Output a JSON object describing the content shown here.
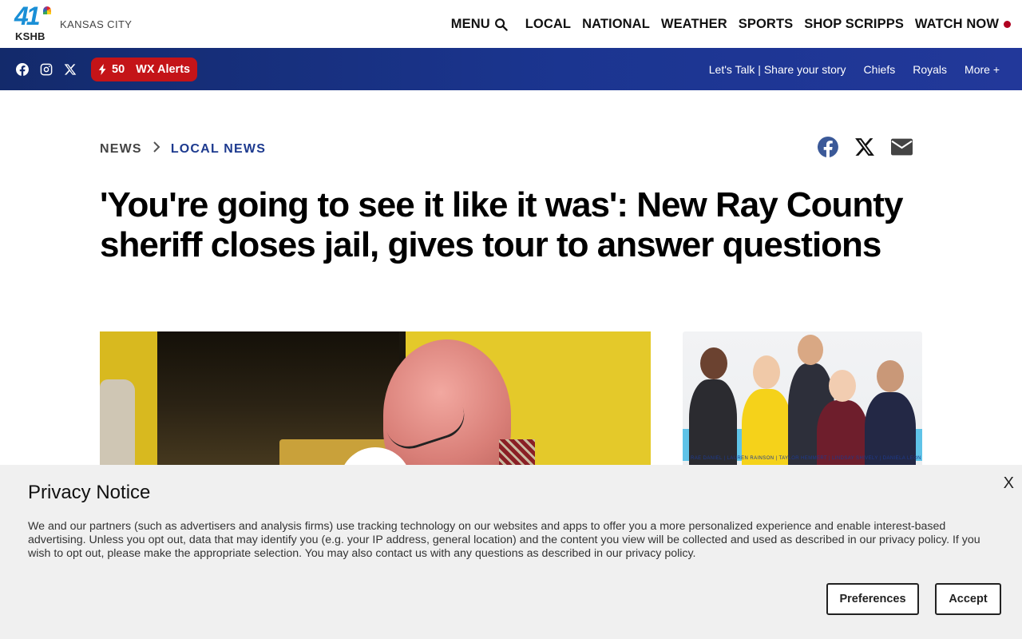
{
  "header": {
    "logo_number": "41",
    "logo_call": "KSHB",
    "city": "KANSAS CITY",
    "nav": [
      {
        "label": "MENU"
      },
      {
        "label": "LOCAL"
      },
      {
        "label": "NATIONAL"
      },
      {
        "label": "WEATHER"
      },
      {
        "label": "SPORTS"
      },
      {
        "label": "SHOP SCRIPPS"
      },
      {
        "label": "WATCH NOW"
      }
    ]
  },
  "subbar": {
    "social_icons": [
      "facebook-icon",
      "instagram-icon",
      "x-icon"
    ],
    "alerts_count": "50",
    "alerts_label": "WX Alerts",
    "links": [
      {
        "label": "Let's Talk | Share your story"
      },
      {
        "label": "Chiefs"
      },
      {
        "label": "Royals"
      },
      {
        "label": "More +"
      }
    ]
  },
  "article": {
    "breadcrumb": [
      "NEWS",
      "LOCAL NEWS"
    ],
    "share_icons": [
      "facebook-icon",
      "x-icon",
      "email-icon"
    ],
    "headline": "'You're going to see it like it was': New Ray County sheriff closes jail, gives tour to answer questions"
  },
  "promo": {
    "caption": "RAE DANIEL  |  LAUREN RAINSON  |  TAYLOR HEMMERT  |  LINDSAY SHIVELY  |  DANIELA LEON"
  },
  "privacy": {
    "title": "Privacy Notice",
    "close": "X",
    "body": "We and our partners (such as advertisers and analysis firms) use tracking technology on our websites and apps to offer you a more personalized experience and enable interest-based advertising. Unless you opt out, data that may identify you (e.g. your IP address, general location) and the content you view will be collected and used as described in our privacy policy. If you wish to opt out, please make the appropriate selection. You may also contact us with any questions as described in our privacy policy.",
    "preferences_label": "Preferences",
    "accept_label": "Accept"
  },
  "colors": {
    "brand_blue": "#1b3590",
    "alert_red": "#c41418",
    "link_blue": "#1d3a8f",
    "logo_blue": "#1a8fd6"
  }
}
